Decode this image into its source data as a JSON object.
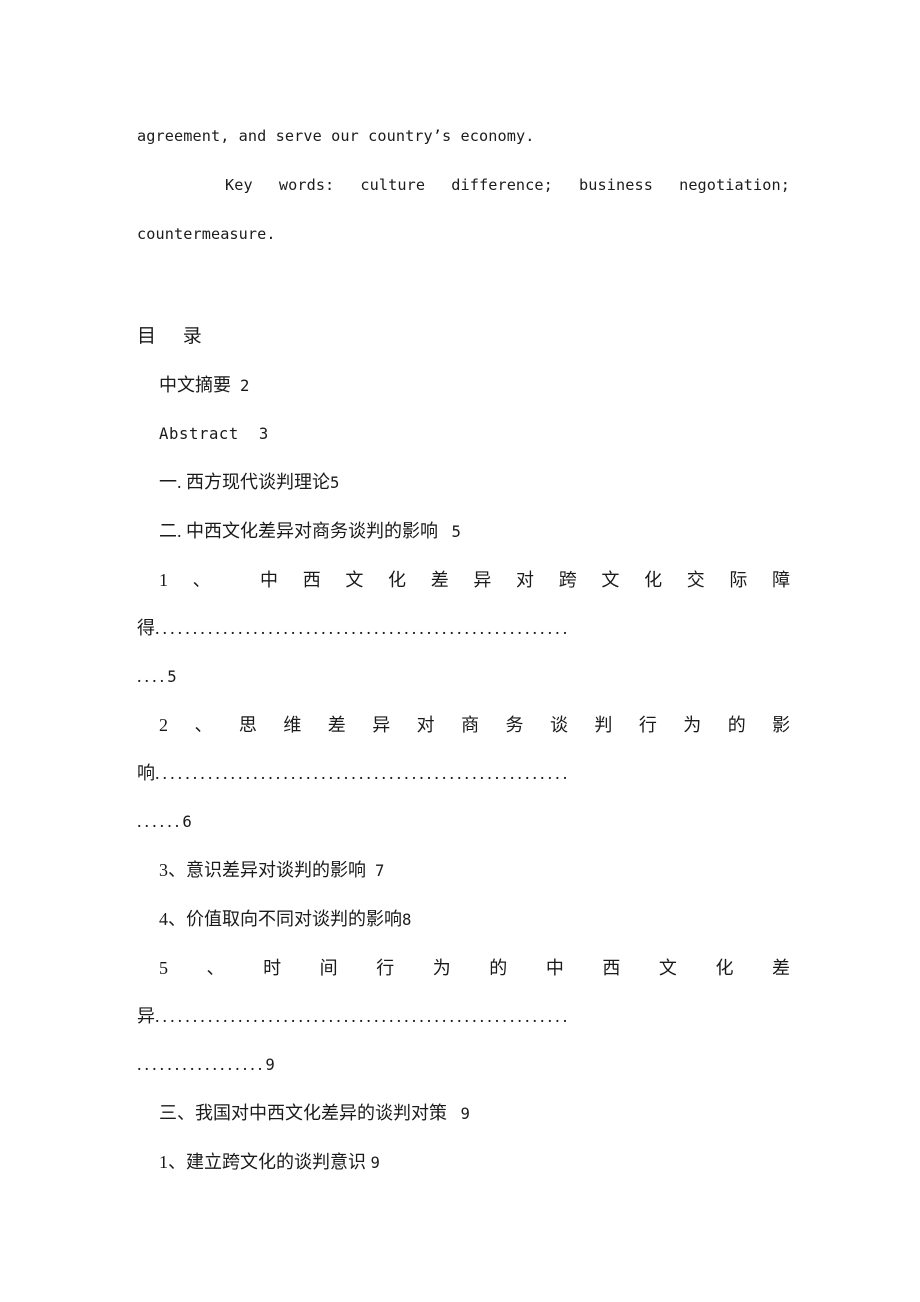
{
  "document": {
    "type": "thesis-table-of-contents-page",
    "page_background": "#ffffff",
    "text_color": "#1a1a1a"
  },
  "abstract": {
    "tail_line": "agreement, and serve our country’s economy.",
    "keywords_indent": "        ",
    "keywords_line": "Key words: culture difference; business negotiation;",
    "keywords_wrap": "countermeasure."
  },
  "toc": {
    "title": "目     录",
    "entries": [
      {
        "id": "cn-abstract",
        "label": "中文摘要",
        "gap": "  ",
        "page": "2",
        "style": "plain"
      },
      {
        "id": "en-abstract",
        "label": "Abstract",
        "gap": "  ",
        "page": "3",
        "style": "mono"
      },
      {
        "id": "chapter-1",
        "label": "一. 西方现代谈判理论",
        "gap": "",
        "page": "5",
        "style": "plain"
      },
      {
        "id": "chapter-2",
        "label": "二. 中西文化差异对商务谈判的影响",
        "gap": "   ",
        "page": "5",
        "style": "plain"
      },
      {
        "id": "section-2-1",
        "number": "1",
        "mark": "、",
        "spread_chars": [
          "1",
          "、",
          "",
          "中",
          "西",
          "文",
          "化",
          "差",
          "异",
          "对",
          "跨",
          "文",
          "化",
          "交",
          "际",
          "障"
        ],
        "wrap_char": "得",
        "wrap_dots": ".......................................................",
        "tail_dots": "....",
        "page": "5",
        "style": "spread"
      },
      {
        "id": "section-2-2",
        "number": "2",
        "mark": "、",
        "spread_chars": [
          "2",
          "、",
          "思",
          "维",
          "差",
          "异",
          "对",
          "商",
          "务",
          "谈",
          "判",
          "行",
          "为",
          "的",
          "影"
        ],
        "wrap_char": "响",
        "wrap_dots": ".......................................................",
        "tail_dots": "......",
        "page": "6",
        "style": "spread"
      },
      {
        "id": "section-2-3",
        "label": "3、意识差异对谈判的影响",
        "gap": "  ",
        "page": "7",
        "style": "plain"
      },
      {
        "id": "section-2-4",
        "label": "4、价值取向不同对谈判的影响",
        "gap": "",
        "page": "8",
        "style": "plain"
      },
      {
        "id": "section-2-5",
        "number": "5",
        "mark": "、",
        "spread_chars": [
          "5",
          "、",
          "时",
          "间",
          "行",
          "为",
          "的",
          "中",
          "西",
          "文",
          "化",
          "差"
        ],
        "wrap_char": "异",
        "wrap_dots": ".......................................................",
        "tail_dots": ".................",
        "page": "9",
        "style": "spread"
      },
      {
        "id": "chapter-3",
        "label": "三、我国对中西文化差异的谈判对策",
        "gap": "   ",
        "page": "9",
        "style": "plain"
      },
      {
        "id": "section-3-1",
        "label": "1、建立跨文化的谈判意识",
        "gap": " ",
        "page": "9",
        "style": "plain"
      }
    ]
  }
}
